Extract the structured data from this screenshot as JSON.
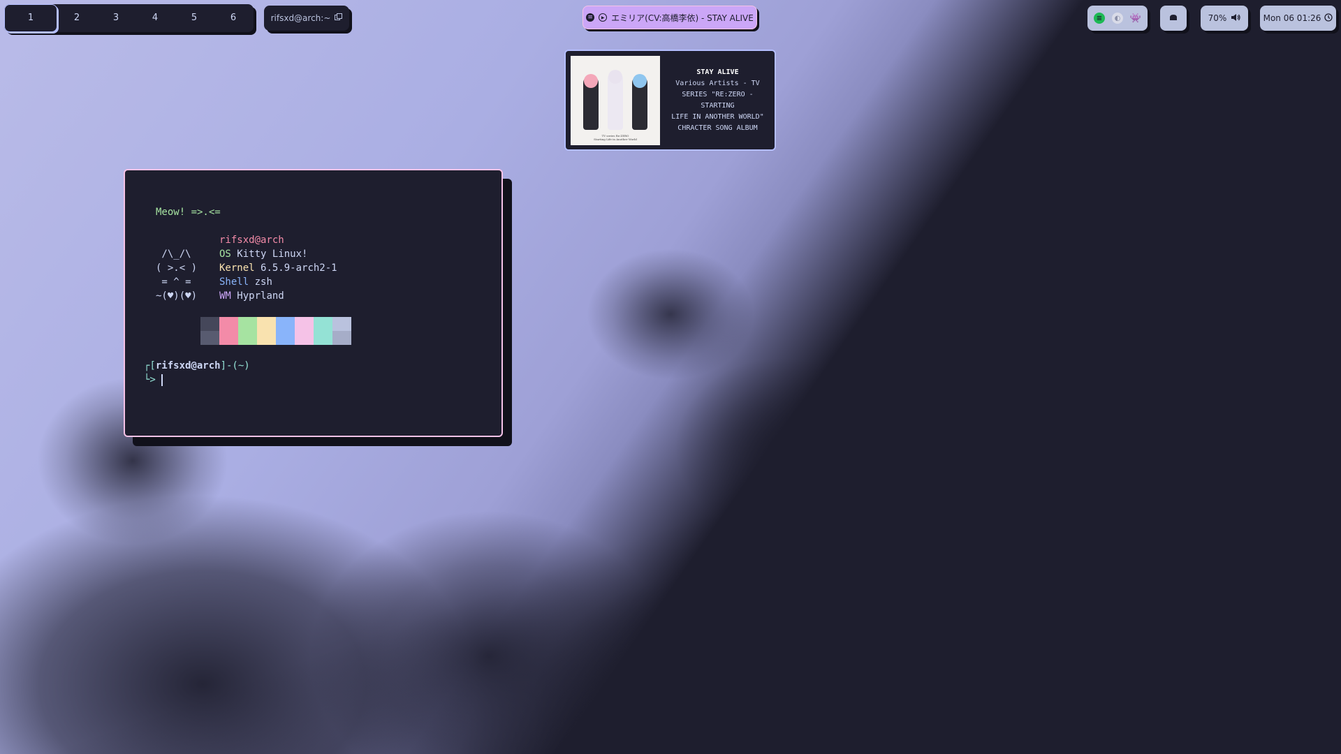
{
  "workspaces": {
    "items": [
      "1",
      "2",
      "3",
      "4",
      "5",
      "6"
    ],
    "active": "1"
  },
  "window_title": {
    "label": "rifsxd@arch:~",
    "icon": "window-icon"
  },
  "media_pill": {
    "label": "エミリア(CV:高橋李依) - STAY ALIVE",
    "icons": [
      "spotify-icon",
      "play-icon"
    ]
  },
  "tray": {
    "icons": [
      "spotify-icon",
      "steam-icon",
      "discord-icon"
    ]
  },
  "notifications": {
    "icon": "notification-icon"
  },
  "volume": {
    "label": "70%",
    "icon": "speaker-icon"
  },
  "clock": {
    "label": "Mon 06 01:26",
    "icon": "clock-icon"
  },
  "media_card": {
    "title": "STAY ALIVE",
    "artist_lines": [
      "Various Artists - TV",
      "SERIES \"RE:ZERO -STARTING",
      "LIFE IN ANOTHER WORLD\"",
      "CHRACTER SONG ALBUM"
    ],
    "album_caption_1": "TV series Re:ZERO",
    "album_caption_2": "Starting Life in Another World"
  },
  "terminal": {
    "greeting": "Meow! =>.<=",
    "user_host": "rifsxd@arch",
    "ascii": [
      " /\\_/\\",
      "( >.< )",
      " = ^ =",
      "~(♥)(♥)"
    ],
    "info": [
      {
        "key": "OS",
        "value": "Kitty Linux!",
        "color": "#a6e3a1"
      },
      {
        "key": "Kernel",
        "value": "6.5.9-arch2-1",
        "color": "#f9e2af"
      },
      {
        "key": "Shell",
        "value": "zsh",
        "color": "#89b4fa"
      },
      {
        "key": "WM",
        "value": "Hyprland",
        "color": "#cba6f7"
      }
    ],
    "palette_top": [
      "#45475a",
      "#f38ba8",
      "#a6e3a1",
      "#f9e2af",
      "#89b4fa",
      "#f5c2e7",
      "#94e2d5",
      "#bac2de"
    ],
    "palette_bottom": [
      "#585b70",
      "#f38ba8",
      "#a6e3a1",
      "#f9e2af",
      "#89b4fa",
      "#f5c2e7",
      "#94e2d5",
      "#a6adc8"
    ],
    "prompt_open": "┌[",
    "prompt_user": "rifsxd@arch",
    "prompt_close": "]-(~)",
    "prompt_arrow": "└>"
  },
  "colors": {
    "bg": "#1e1e2e",
    "accent": "#cba6f7",
    "border_terminal": "#f5c2e7",
    "border_card": "#b4befe"
  }
}
